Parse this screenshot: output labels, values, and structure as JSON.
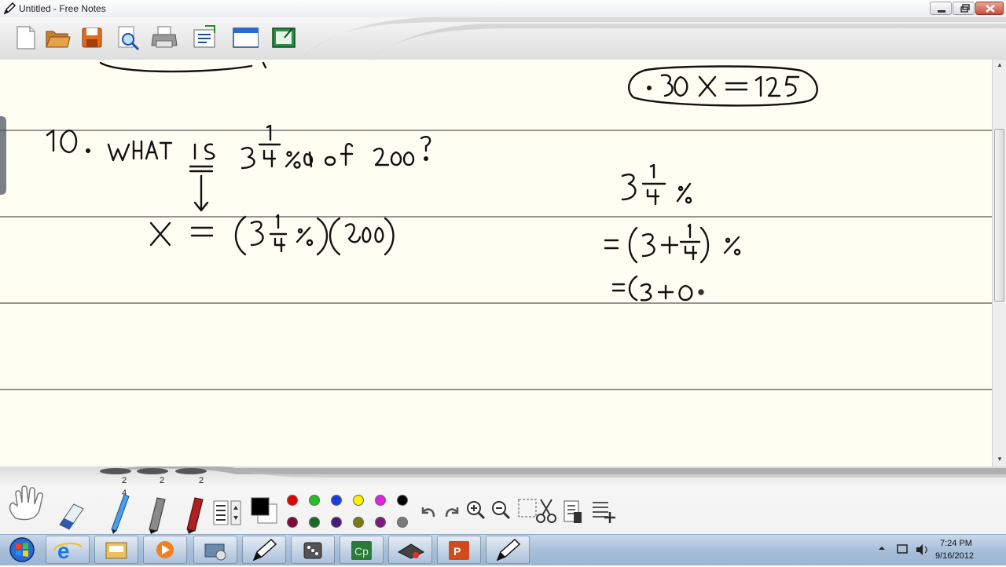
{
  "window": {
    "title": "Untitled - Free Notes"
  },
  "toolbar": {
    "buttons": [
      {
        "name": "new-file-icon"
      },
      {
        "name": "open-folder-icon"
      },
      {
        "name": "save-icon"
      },
      {
        "name": "print-preview-icon"
      },
      {
        "name": "print-icon"
      },
      {
        "name": "export-icon"
      },
      {
        "name": "window-icon"
      },
      {
        "name": "screen-capture-icon"
      }
    ]
  },
  "toolbox": {
    "size_labels": [
      "2",
      "2",
      "2"
    ],
    "pen_size_small": "4",
    "colors_row1": [
      "#e00000",
      "#22c022",
      "#1a3de0",
      "#f8f000",
      "#e020e0",
      "#000000"
    ],
    "colors_row2": [
      "#7a0a3a",
      "#1a6a2a",
      "#4a1a7a",
      "#7a7a10",
      "#7a1a7a",
      "#7a7a7a"
    ]
  },
  "taskbar": {
    "time": "7:24 PM",
    "date": "9/16/2012",
    "apps": [
      "ie-icon",
      "explorer-icon",
      "media-player-icon",
      "network-tool-icon",
      "free-notes-icon",
      "dice-app-icon",
      "captivate-icon",
      "hat-app-icon",
      "powerpoint-icon",
      "free-notes-icon-2"
    ]
  }
}
